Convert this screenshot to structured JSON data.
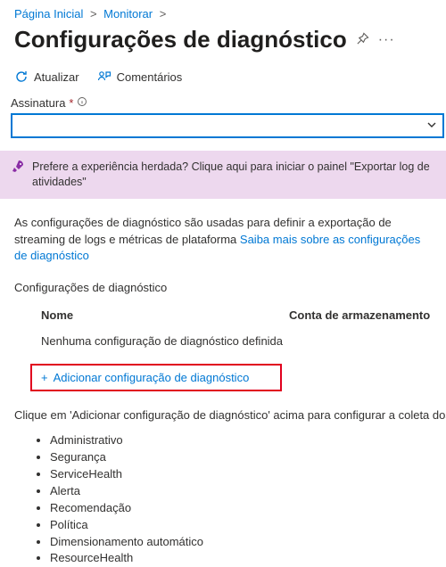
{
  "breadcrumb": {
    "home": "Página Inicial",
    "monitor": "Monitorar"
  },
  "page_title": "Configurações de diagnóstico",
  "toolbar": {
    "refresh": "Atualizar",
    "feedback": "Comentários"
  },
  "subscription": {
    "label": "Assinatura",
    "required": "*"
  },
  "banner": {
    "text": "Prefere a experiência herdada? Clique aqui para iniciar o painel \"Exportar log de atividades\""
  },
  "intro": {
    "text": "As configurações de diagnóstico são usadas para definir a exportação de streaming de logs e métricas de plataforma ",
    "link": "Saiba mais sobre as configurações de diagnóstico"
  },
  "section": {
    "subheading": "Configurações de diagnóstico",
    "col_name": "Nome",
    "col_account": "Conta de armazenamento",
    "empty": "Nenhuma configuração de diagnóstico definida",
    "add": "Adicionar configuração de diagnóstico"
  },
  "instruction": "Clique em 'Adicionar configuração de diagnóstico' acima para configurar a coleta dos",
  "log_types": [
    "Administrativo",
    "Segurança",
    "ServiceHealth",
    "Alerta",
    "Recomendação",
    "Política",
    "Dimensionamento automático",
    "ResourceHealth"
  ]
}
